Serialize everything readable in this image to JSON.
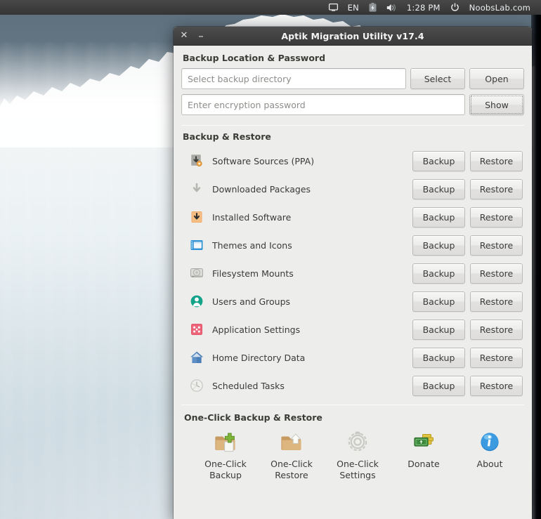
{
  "panel": {
    "items": [
      {
        "name": "display-icon",
        "type": "icon",
        "label": ""
      },
      {
        "name": "keyboard-layout-indicator",
        "type": "text",
        "label": "EN"
      },
      {
        "name": "battery-charging-icon",
        "type": "icon",
        "label": ""
      },
      {
        "name": "volume-icon",
        "type": "icon",
        "label": ""
      },
      {
        "name": "clock",
        "type": "text",
        "label": "1:28 PM"
      },
      {
        "name": "power-icon",
        "type": "icon",
        "label": ""
      },
      {
        "name": "session-user-menu",
        "type": "text",
        "label": "NoobsLab.com"
      }
    ]
  },
  "window": {
    "title": "Aptik Migration Utility v17.4",
    "close_label": "✕",
    "minimize_label": "–"
  },
  "backup_location": {
    "heading": "Backup Location & Password",
    "directory_placeholder": "Select backup directory",
    "directory_value": "",
    "select_label": "Select",
    "open_label": "Open",
    "password_placeholder": "Enter encryption password",
    "password_value": "",
    "show_label": "Show"
  },
  "backup_restore": {
    "heading": "Backup & Restore",
    "backup_label": "Backup",
    "restore_label": "Restore",
    "items": [
      {
        "label": "Software Sources (PPA)",
        "icon": "ppa-icon"
      },
      {
        "label": "Downloaded Packages",
        "icon": "download-arrow-icon"
      },
      {
        "label": "Installed Software",
        "icon": "package-install-icon"
      },
      {
        "label": "Themes and Icons",
        "icon": "theme-window-icon"
      },
      {
        "label": "Filesystem Mounts",
        "icon": "harddisk-icon"
      },
      {
        "label": "Users and Groups",
        "icon": "user-icon"
      },
      {
        "label": "Application Settings",
        "icon": "preferences-icon"
      },
      {
        "label": "Home Directory Data",
        "icon": "home-folder-icon"
      },
      {
        "label": "Scheduled Tasks",
        "icon": "clock-icon"
      }
    ]
  },
  "one_click": {
    "heading": "One-Click Backup & Restore",
    "buttons": [
      {
        "label": "One-Click\nBackup",
        "line1": "One-Click",
        "line2": "Backup",
        "icon": "folder-add-icon"
      },
      {
        "label": "One-Click\nRestore",
        "line1": "One-Click",
        "line2": "Restore",
        "icon": "folder-up-icon"
      },
      {
        "label": "One-Click\nSettings",
        "line1": "One-Click",
        "line2": "Settings",
        "icon": "gear-icon"
      },
      {
        "label": "Donate",
        "line1": "Donate",
        "line2": "",
        "icon": "money-icon"
      },
      {
        "label": "About",
        "line1": "About",
        "line2": "",
        "icon": "info-icon"
      }
    ]
  },
  "colors": {
    "panel_bg": "#3e3e3e",
    "titlebar_bg": "#434343",
    "window_bg": "#ededeb",
    "accent_orange": "#f2a35e",
    "accent_green": "#16a085",
    "accent_blue": "#3498db",
    "accent_red": "#e4556b",
    "text": "#3a3a38"
  }
}
